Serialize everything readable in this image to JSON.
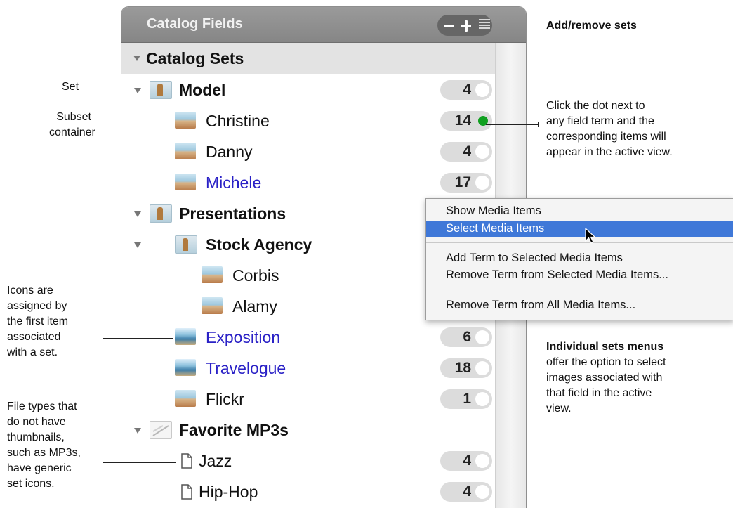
{
  "panel": {
    "title": "Catalog Fields",
    "controls": [
      "remove-set",
      "add-set",
      "list-options"
    ],
    "section_header": "Catalog Sets"
  },
  "rows": [
    {
      "label": "Model",
      "count": "4",
      "style": "bold",
      "icon": "set-icon",
      "active": false
    },
    {
      "label": "Christine",
      "count": "14",
      "style": "normal",
      "icon": "photo-icon",
      "active": true
    },
    {
      "label": "Danny",
      "count": "4",
      "style": "normal",
      "icon": "photo-icon",
      "active": false
    },
    {
      "label": "Michele",
      "count": "17",
      "style": "blue",
      "icon": "photo-icon",
      "active": false
    },
    {
      "label": "Presentations",
      "count": "",
      "style": "bold",
      "icon": "set-icon",
      "active": false
    },
    {
      "label": "Stock Agency",
      "count": "",
      "style": "bold",
      "icon": "set-icon",
      "active": false
    },
    {
      "label": "Corbis",
      "count": "",
      "style": "normal",
      "icon": "photo-icon",
      "active": false
    },
    {
      "label": "Alamy",
      "count": "",
      "style": "normal",
      "icon": "photo-icon",
      "active": false
    },
    {
      "label": "Exposition",
      "count": "6",
      "style": "blue",
      "icon": "beach-icon",
      "active": false
    },
    {
      "label": "Travelogue",
      "count": "18",
      "style": "blue",
      "icon": "beach-icon",
      "active": false
    },
    {
      "label": "Flickr",
      "count": "1",
      "style": "normal",
      "icon": "photo-icon",
      "active": false
    },
    {
      "label": "Favorite MP3s",
      "count": "",
      "style": "bold",
      "icon": "mp3-set-icon",
      "active": false
    },
    {
      "label": "Jazz",
      "count": "4",
      "style": "normal",
      "icon": "document-icon",
      "active": false
    },
    {
      "label": "Hip-Hop",
      "count": "4",
      "style": "normal",
      "icon": "document-icon",
      "active": false
    }
  ],
  "context_menu": {
    "items": [
      {
        "label": "Show Media Items",
        "selected": false
      },
      {
        "label": "Select Media Items",
        "selected": true
      },
      {
        "label": "Add Term to Selected Media Items",
        "selected": false
      },
      {
        "label": "Remove Term from Selected Media Items...",
        "selected": false
      },
      {
        "label": "Remove Term from All Media Items...",
        "selected": false
      }
    ]
  },
  "annotations": {
    "add_remove": "Add/remove sets",
    "click_dot": [
      "Click the dot next to",
      "any field term and the",
      "corresponding items will",
      "appear in the active view."
    ],
    "set": "Set",
    "subset": [
      "Subset",
      "container"
    ],
    "icons": [
      "Icons are",
      "assigned by",
      "the first item",
      "associated",
      "with a set."
    ],
    "file_types": [
      "File types that",
      "do not have",
      "thumbnails,",
      "such as MP3s,",
      "have generic",
      "set icons."
    ],
    "menus_title": "Individual sets menus",
    "menus_body": [
      "offer the option to select",
      "images associated with",
      "that field in the active",
      "view."
    ]
  },
  "colors": {
    "titlebar": "#8f8f8f",
    "active_dot": "#10a020",
    "selected_menu": "#3f78d8",
    "linked_text": "#2a21c6"
  }
}
